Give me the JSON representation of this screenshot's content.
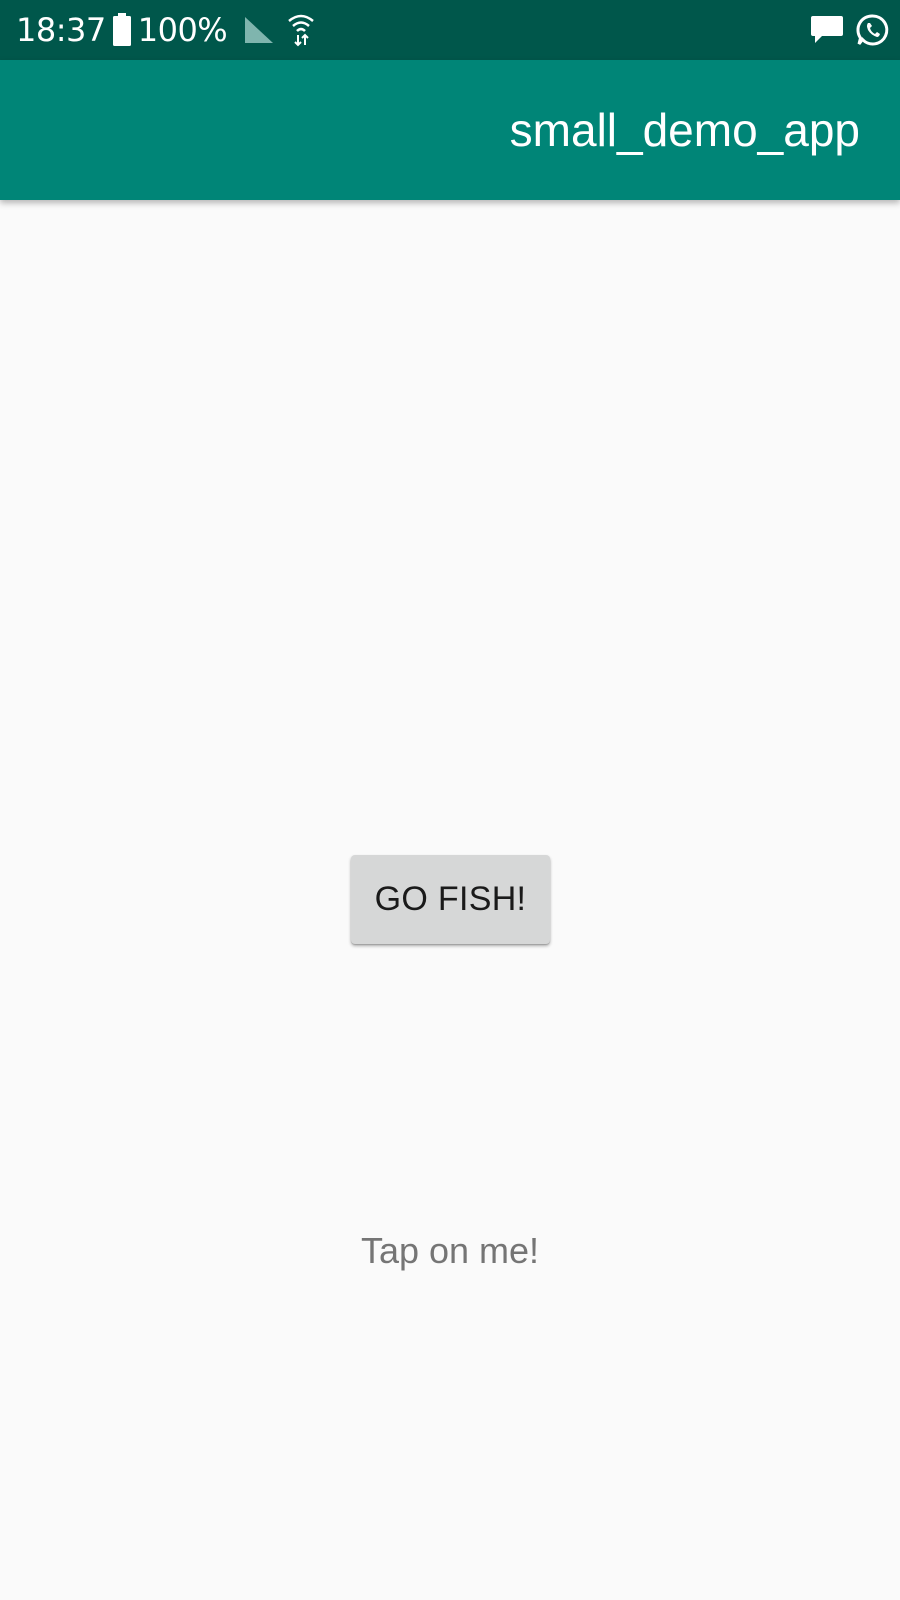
{
  "status_bar": {
    "time": "18:37",
    "battery_percent": "100%",
    "background_color": "#00574b",
    "icons": [
      "battery-icon",
      "signal-icon",
      "wifi-icon",
      "message-icon",
      "whatsapp-icon"
    ]
  },
  "app_bar": {
    "title": "small_demo_app",
    "background_color": "#008577"
  },
  "main": {
    "button_label": "GO FISH!",
    "tap_text": "Tap on me!"
  }
}
